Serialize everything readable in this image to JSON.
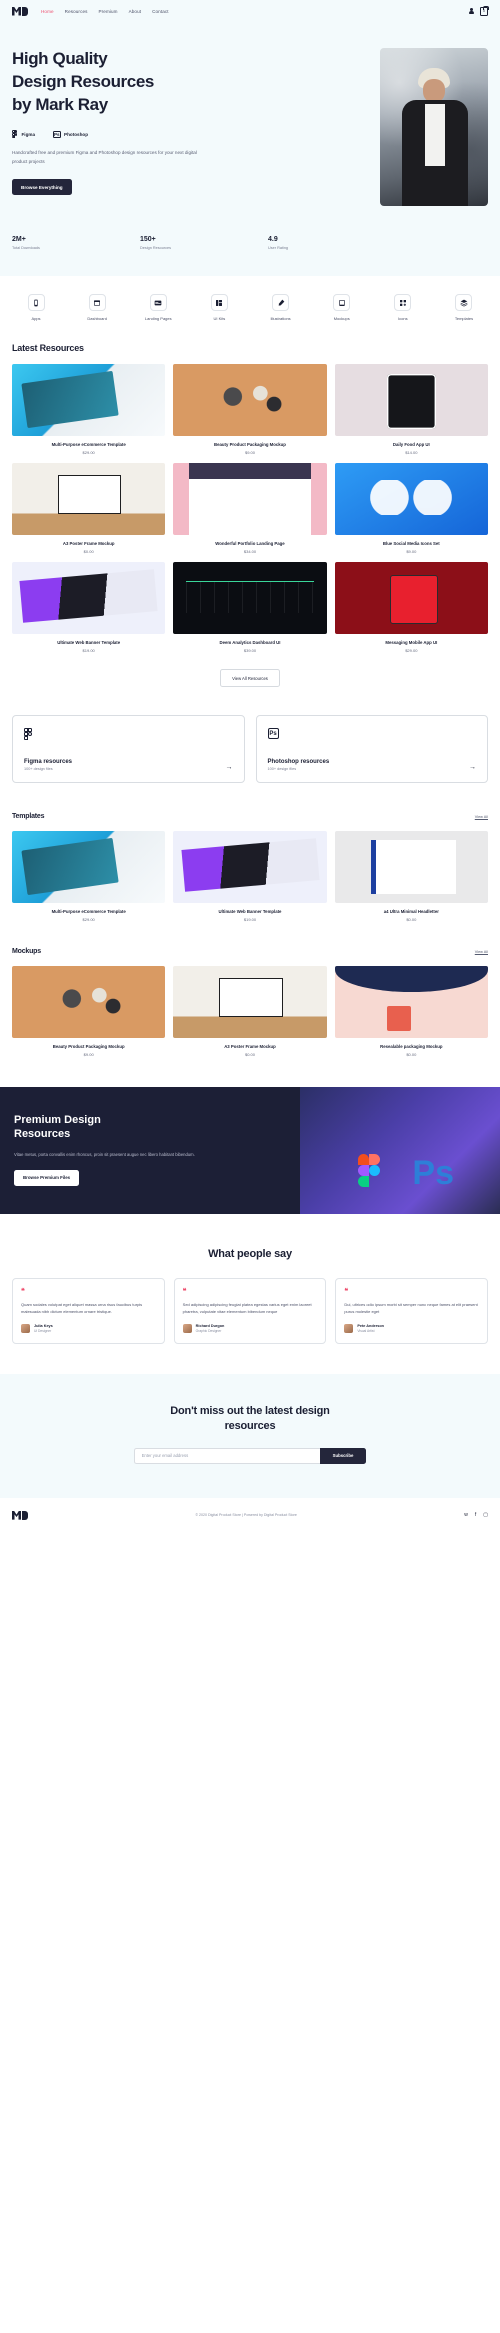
{
  "nav": {
    "logo": "MR",
    "links": [
      {
        "label": "Home",
        "active": true
      },
      {
        "label": "Resources",
        "active": false
      },
      {
        "label": "Premium",
        "active": false
      },
      {
        "label": "About",
        "active": false
      },
      {
        "label": "Contact",
        "active": false
      }
    ],
    "account_icon": "user-icon",
    "cart_icon": "cart-icon",
    "cart_count": "0"
  },
  "hero": {
    "title_line1": "High Quality",
    "title_line2": "Design Resources",
    "title_line3": "by Mark Ray",
    "badges": [
      {
        "label": "Figma",
        "icon": "figma-icon"
      },
      {
        "label": "Photoshop",
        "icon": "photoshop-icon"
      }
    ],
    "description": "Handcrafted free and premium Figma and Photoshop design resources for your next digital product projects",
    "cta": "Browse Everything",
    "image_alt": "man-portrait-photo",
    "stats": [
      {
        "value": "2M+",
        "label": "Total Downloads"
      },
      {
        "value": "150+",
        "label": "Design Resources"
      },
      {
        "value": "4.9",
        "label": "User Rating"
      }
    ]
  },
  "categories": [
    {
      "label": "Apps",
      "icon": "mobile-icon"
    },
    {
      "label": "Dashboard",
      "icon": "window-icon"
    },
    {
      "label": "Landing Pages",
      "icon": "browser-icon"
    },
    {
      "label": "UI Kits",
      "icon": "layers-blocks-icon"
    },
    {
      "label": "Illustrations",
      "icon": "pen-icon"
    },
    {
      "label": "Mockups",
      "icon": "tablet-icon"
    },
    {
      "label": "Icons",
      "icon": "icons-grid-icon"
    },
    {
      "label": "Templates",
      "icon": "stack-icon"
    }
  ],
  "latest": {
    "title": "Latest Resources",
    "cards": [
      {
        "title": "Multi-Purpose eCommerce Template",
        "price": "$29.00",
        "art": "t-ecom"
      },
      {
        "title": "Beauty Product Packaging Mockup",
        "price": "$9.00",
        "art": "t-beauty"
      },
      {
        "title": "Daily Food App UI",
        "price": "$14.00",
        "art": "t-food"
      },
      {
        "title": "A3 Poster Frame Mockup",
        "price": "$0.00",
        "art": "t-poster"
      },
      {
        "title": "Wonderful Portfolio Landing Page",
        "price": "$34.00",
        "art": "t-portfolio"
      },
      {
        "title": "Blue Social Media Icons Set",
        "price": "$9.00",
        "art": "t-social"
      },
      {
        "title": "Ultimate Web Banner Template",
        "price": "$19.00",
        "art": "t-banner"
      },
      {
        "title": "Deem Analytics Dashboard UI",
        "price": "$39.00",
        "art": "t-deem"
      },
      {
        "title": "Messaging Mobile App UI",
        "price": "$29.00",
        "art": "t-msg"
      }
    ],
    "view_all": "View All Resources"
  },
  "tools": [
    {
      "title": "Figma resources",
      "subtitle": "100+ design files",
      "icon": "figma-icon",
      "arrow": "→"
    },
    {
      "title": "Photoshop resources",
      "subtitle": "100+ design files",
      "icon": "photoshop-icon",
      "arrow": "→"
    }
  ],
  "templates": {
    "title": "Templates",
    "view_all": "View All",
    "cards": [
      {
        "title": "Multi-Purpose eCommerce Template",
        "price": "$29.00",
        "art": "t-ecom"
      },
      {
        "title": "Ultimate Web Banner Template",
        "price": "$19.00",
        "art": "t-banner"
      },
      {
        "title": "a4 Ultra Minimal Headletter",
        "price": "$0.00",
        "art": "t-ultra"
      }
    ]
  },
  "mockups": {
    "title": "Mockups",
    "view_all": "View All",
    "cards": [
      {
        "title": "Beauty Product Packaging Mockup",
        "price": "$9.00",
        "art": "t-beauty"
      },
      {
        "title": "A3 Poster Frame Mockup",
        "price": "$0.00",
        "art": "t-poster"
      },
      {
        "title": "Resealable packaging Mockup",
        "price": "$0.00",
        "art": "t-resealable"
      }
    ]
  },
  "premium": {
    "title_line1": "Premium Design",
    "title_line2": "Resources",
    "description": "Vitae metus, porta convallis enim rhoncus, proin sit praesent augue nec libero habitant bibendum.",
    "cta": "Browse Premium Files"
  },
  "testimonials": {
    "title": "What people say",
    "items": [
      {
        "quote": "Quam sodales volutpat eget aliquet massa urna risus faucibus turpis malesuada nibh dictum elementum ornare tristique.",
        "name": "Julia Keys",
        "role": "Ui Designer"
      },
      {
        "quote": "Sed adipiscing adipiscing feugiat platea egestas varius eget enim laoreet pharetra, vulputate vitae elementum bibendum neque",
        "name": "Richard Durgon",
        "role": "Graphic Designer"
      },
      {
        "quote": "Dui, ultrices odio ipsum morbi sit semper nunc neque fames at elit praesent purus molestie eget",
        "name": "Pete Anderson",
        "role": "Visual Artist"
      }
    ]
  },
  "newsletter": {
    "title_line1": "Don't miss out the latest design",
    "title_line2": "resources",
    "placeholder": "Enter your email address",
    "value": "",
    "button": "Subscribe"
  },
  "footer": {
    "logo": "MR",
    "copyright": "© 2020 Digital Product Store | Powered by Digital Product Store",
    "socials": [
      "twitter-icon",
      "facebook-icon",
      "instagram-icon"
    ]
  },
  "colors": {
    "accent": "#ee4e6e",
    "dark": "#24263b",
    "light_bg": "#f3fafc"
  }
}
